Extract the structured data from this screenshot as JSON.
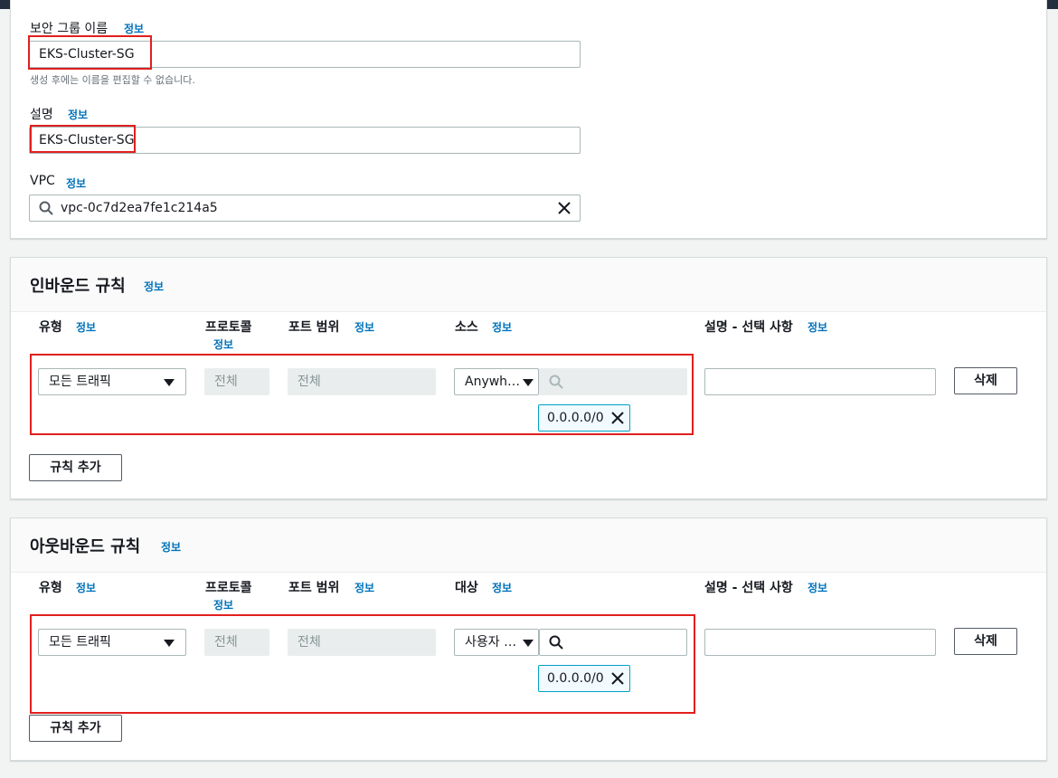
{
  "top_section": {
    "name_label": "보안 그룹 이름",
    "name_info": "정보",
    "name_value": "EKS-Cluster-SG",
    "name_hint": "생성 후에는 이름을 편집할 수 없습니다.",
    "desc_label": "설명",
    "desc_info": "정보",
    "desc_value": "EKS-Cluster-SG",
    "vpc_label": "VPC",
    "vpc_info": "정보",
    "vpc_value": "vpc-0c7d2ea7fe1c214a5"
  },
  "inbound": {
    "title": "인바운드 규칙",
    "title_info": "정보",
    "col_type": "유형",
    "col_type_info": "정보",
    "col_protocol": "프로토콜",
    "col_protocol_info": "정보",
    "col_port": "포트 범위",
    "col_port_info": "정보",
    "col_source": "소스",
    "col_source_info": "정보",
    "col_desc": "설명 - 선택 사항",
    "col_desc_info": "정보",
    "rule": {
      "type": "모든 트래픽",
      "protocol": "전체",
      "port": "전체",
      "source_select": "Anywh…",
      "cidr": "0.0.0.0/0",
      "description": "",
      "delete_label": "삭제"
    },
    "add_rule_label": "규칙 추가"
  },
  "outbound": {
    "title": "아웃바운드 규칙",
    "title_info": "정보",
    "col_type": "유형",
    "col_type_info": "정보",
    "col_protocol": "프로토콜",
    "col_protocol_info": "정보",
    "col_port": "포트 범위",
    "col_port_info": "정보",
    "col_dest": "대상",
    "col_dest_info": "정보",
    "col_desc": "설명 - 선택 사항",
    "col_desc_info": "정보",
    "rule": {
      "type": "모든 트래픽",
      "protocol": "전체",
      "port": "전체",
      "dest_select": "사용자 …",
      "cidr": "0.0.0.0/0",
      "description": "",
      "delete_label": "삭제"
    },
    "add_rule_label": "규칙 추가"
  },
  "colors": {
    "accent": "#0073bb",
    "highlight": "#e0201f",
    "token_border": "#00a1c9"
  }
}
